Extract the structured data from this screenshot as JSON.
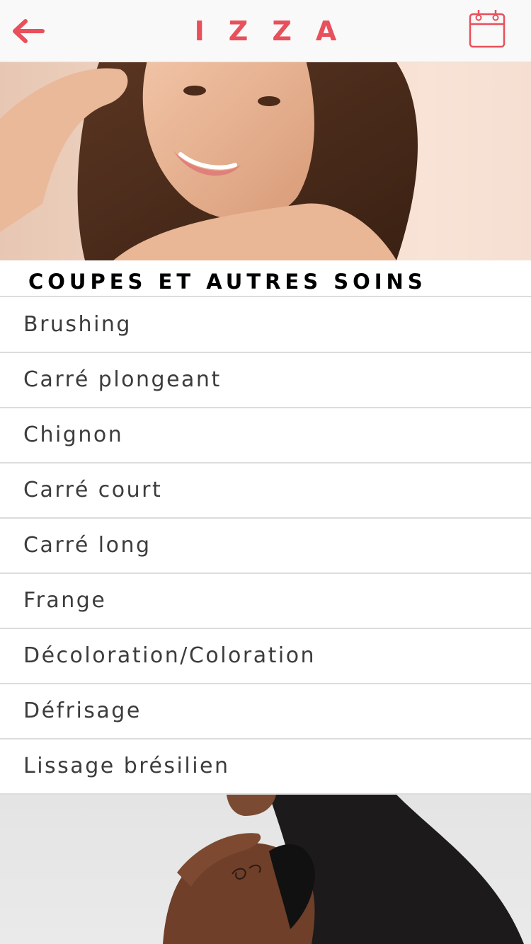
{
  "header": {
    "brand": "IZZA",
    "back_icon": "arrow-left-icon",
    "calendar_icon": "calendar-icon",
    "accent_color": "#e8505b"
  },
  "hero": {
    "image": "smiling-woman-brown-hair-photo"
  },
  "section": {
    "title": "COUPES ET AUTRES SOINS"
  },
  "services": [
    {
      "label": "Brushing"
    },
    {
      "label": "Carré plongeant"
    },
    {
      "label": "Chignon"
    },
    {
      "label": "Carré court"
    },
    {
      "label": "Carré long"
    },
    {
      "label": "Frange"
    },
    {
      "label": "Décoloration/Coloration"
    },
    {
      "label": "Défrisage"
    },
    {
      "label": "Lissage brésilien"
    }
  ],
  "footer": {
    "image": "woman-long-dark-hair-photo"
  }
}
